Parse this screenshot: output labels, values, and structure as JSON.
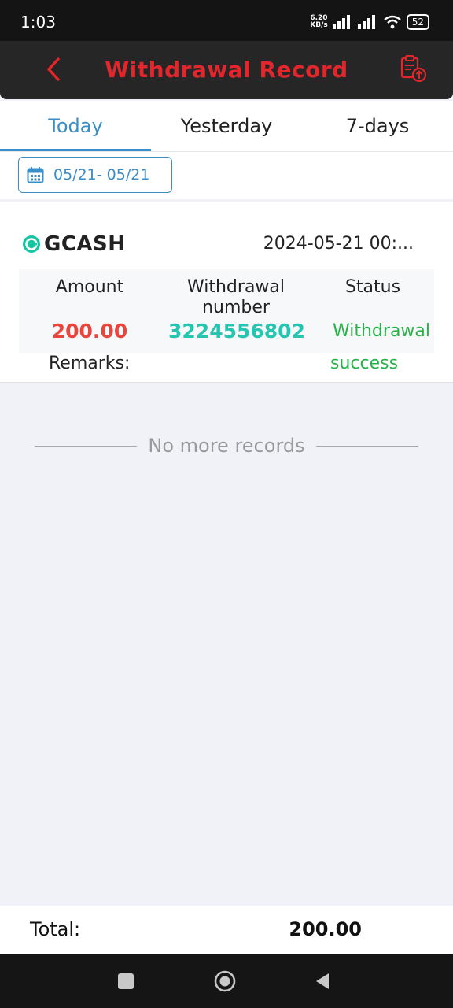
{
  "status_bar": {
    "time": "1:03",
    "net_speed_value": "6.20",
    "net_speed_unit": "KB/s",
    "battery": "52"
  },
  "header": {
    "title": "Withdrawal Record",
    "back_icon": "chevron-left-icon",
    "record_icon": "clipboard-upload-icon",
    "accent_color": "#e3262c"
  },
  "tabs": [
    {
      "label": "Today",
      "active": true
    },
    {
      "label": "Yesterday",
      "active": false
    },
    {
      "label": "7-days",
      "active": false
    }
  ],
  "date_filter": {
    "range": "05/21- 05/21",
    "icon": "calendar-icon"
  },
  "records": [
    {
      "provider": "GCASH",
      "datetime": "2024-05-21 00:...",
      "columns": {
        "amount": "Amount",
        "number": "Withdrawal number",
        "status": "Status"
      },
      "amount": "200.00",
      "number": "3224556802",
      "status_line1": "Withdrawal",
      "status_line2": "success",
      "remarks_label": "Remarks:"
    }
  ],
  "no_more": "No more records",
  "total": {
    "label": "Total:",
    "value": "200.00"
  },
  "nav": {
    "recents": "square-icon",
    "home": "circle-icon",
    "back": "triangle-back-icon"
  }
}
